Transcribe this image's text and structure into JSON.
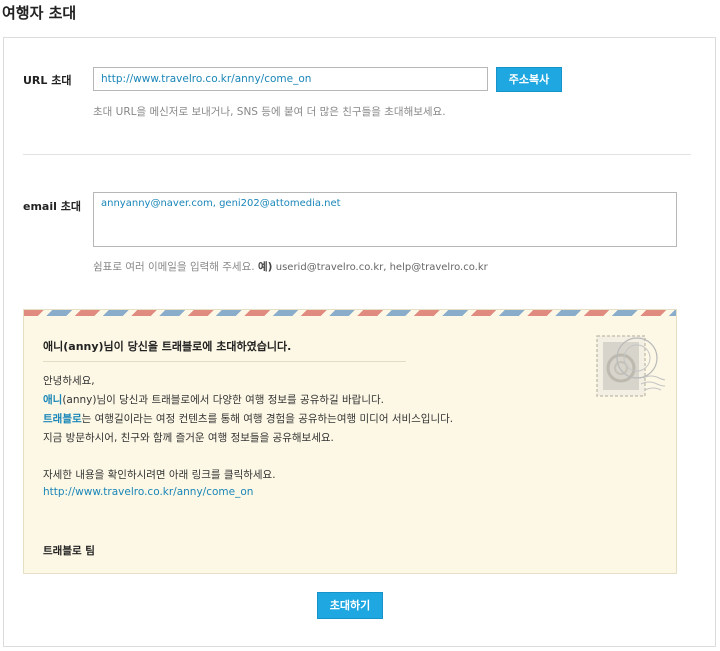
{
  "page": {
    "title": "여행자 초대"
  },
  "url_section": {
    "label": "URL 초대",
    "url_value": "http://www.travelro.co.kr/anny/come_on",
    "copy_button": "주소복사",
    "hint": "초대 URL을 메신저로 보내거나, SNS 등에 붙여 더 많은 친구들을 초대해보세요."
  },
  "email_section": {
    "label": "email 초대",
    "value": "annyanny@naver.com, geni202@attomedia.net",
    "hint_prefix": "쉼표로 여러 이메일을 입력해 주세요.",
    "hint_example_label": "예)",
    "hint_example": "userid@travelro.co.kr, help@travelro.co.kr"
  },
  "letter": {
    "heading": "애니(anny)님이 당신을 트래블로에 초대하였습니다.",
    "greeting": "안녕하세요,",
    "line1_name": "애니",
    "line1_rest": "(anny)님이 당신과 트래블로에서 다양한 여행 정보를 공유하길 바랍니다.",
    "line2_brand": "트래블로",
    "line2_rest": "는 여행길이라는 여정 컨텐츠를 통해 여행 경험을 공유하는여행 미디어 서비스입니다.",
    "line3": "지금 방문하시어, 친구와 함께 즐거운 여행 정보들을 공유해보세요.",
    "line4": "자세한 내용을 확인하시려면 아래 링크를 클릭하세요.",
    "link": "http://www.travelro.co.kr/anny/come_on",
    "signature": "트래블로 팀",
    "stamp_icon": "postage-stamp-icon"
  },
  "actions": {
    "invite_button": "초대하기"
  },
  "colors": {
    "accent": "#1ea7e1",
    "link": "#1a86b8",
    "letter_bg": "#fdf8e6"
  }
}
